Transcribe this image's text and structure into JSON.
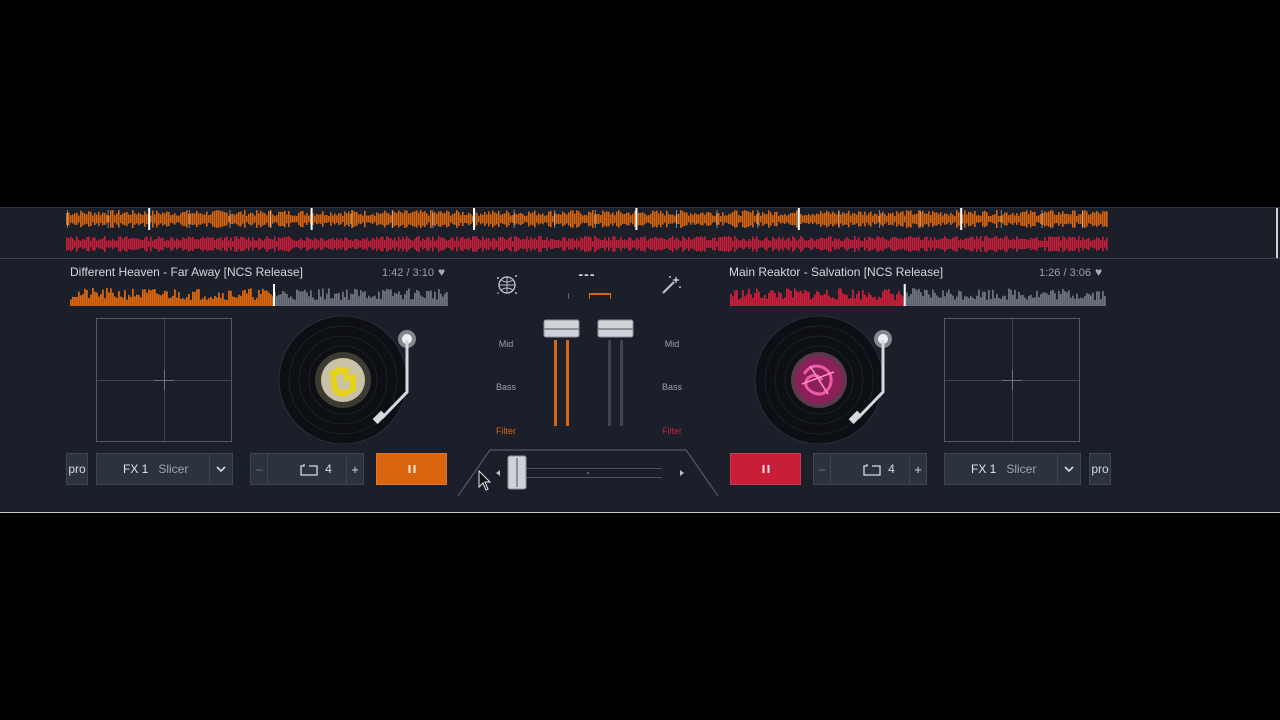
{
  "colors": {
    "deck_a": "#d9650f",
    "deck_b": "#c81e3a",
    "panel": "#1b1f2a",
    "button": "#2c323e"
  },
  "deck_a": {
    "title": "Different Heaven - Far Away [NCS Release]",
    "time": "1:42 / 3:10",
    "favorite_icon": "heart-icon",
    "fx": {
      "label": "FX 1",
      "effect": "Slicer"
    },
    "pro_label": "pro",
    "loop": {
      "minus": "–",
      "value": "4",
      "plus": "+"
    },
    "play_icon": "pause-icon",
    "progress": 0.537,
    "vinyl_label": "ncs-logo"
  },
  "deck_b": {
    "title": "Main Reaktor - Salvation [NCS Release]",
    "time": "1:26 / 3:06",
    "favorite_icon": "heart-icon",
    "fx": {
      "label": "FX 1",
      "effect": "Slicer"
    },
    "pro_label": "pro",
    "loop": {
      "minus": "–",
      "value": "4",
      "plus": "+"
    },
    "play_icon": "pause-icon",
    "progress": 0.462,
    "vinyl_label": "magenta-artwork"
  },
  "mixer": {
    "bpm_display": "---",
    "sync_icon": "disco-ball-icon",
    "effects_icon": "magic-wand-icon",
    "eq_labels": {
      "mid": "Mid",
      "bass": "Bass",
      "filter": "Filter"
    },
    "crossfader_position": 0.1
  }
}
